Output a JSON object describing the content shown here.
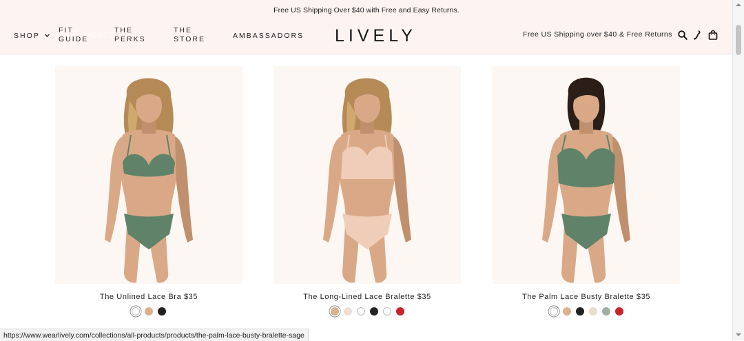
{
  "announcement": "Free US Shipping Over $40 with Free and Easy Returns.",
  "nav": {
    "shop": "SHOP",
    "fit_guide_line1": "FIT",
    "fit_guide_line2": "GUIDE",
    "perks_line1": "THE",
    "perks_line2": "PERKS",
    "store_line1": "THE",
    "store_line2": "STORE",
    "ambassadors": "AMBASSADORS",
    "ghost_heading": "All Products"
  },
  "logo": "LIVELY",
  "header_right": {
    "shipping_text": "Free US Shipping over $40 & Free Returns",
    "icons": [
      "search-icon",
      "phone-icon",
      "shopping-bag-icon"
    ]
  },
  "products": [
    {
      "name": "The Unlined Lace Bra $35",
      "garment_color": "#5f8269",
      "style": "bra",
      "hair": "blonde",
      "swatches": [
        "#ffffff",
        "#d9b18e",
        "#222222"
      ],
      "selected_swatch": 0
    },
    {
      "name": "The Long-Lined Lace Bralette $35",
      "garment_color": "#f0cdb8",
      "style": "longline",
      "hair": "blonde",
      "swatches": [
        "#d9b18e",
        "#f0ddd4",
        "#ffffff",
        "#222222",
        "#ffffff",
        "#c9232d"
      ],
      "selected_swatch": 0
    },
    {
      "name": "The Palm Lace Busty Bralette $35",
      "garment_color": "#5f8269",
      "style": "bralette",
      "hair": "dark",
      "swatches": [
        "#ffffff",
        "#d9b18e",
        "#222222",
        "#eadbd0",
        "#9fada5",
        "#c9232d"
      ],
      "selected_swatch": 0
    }
  ],
  "status_url": "https://www.wearlively.com/collections/all-products/products/the-palm-lace-busty-bralette-sage"
}
